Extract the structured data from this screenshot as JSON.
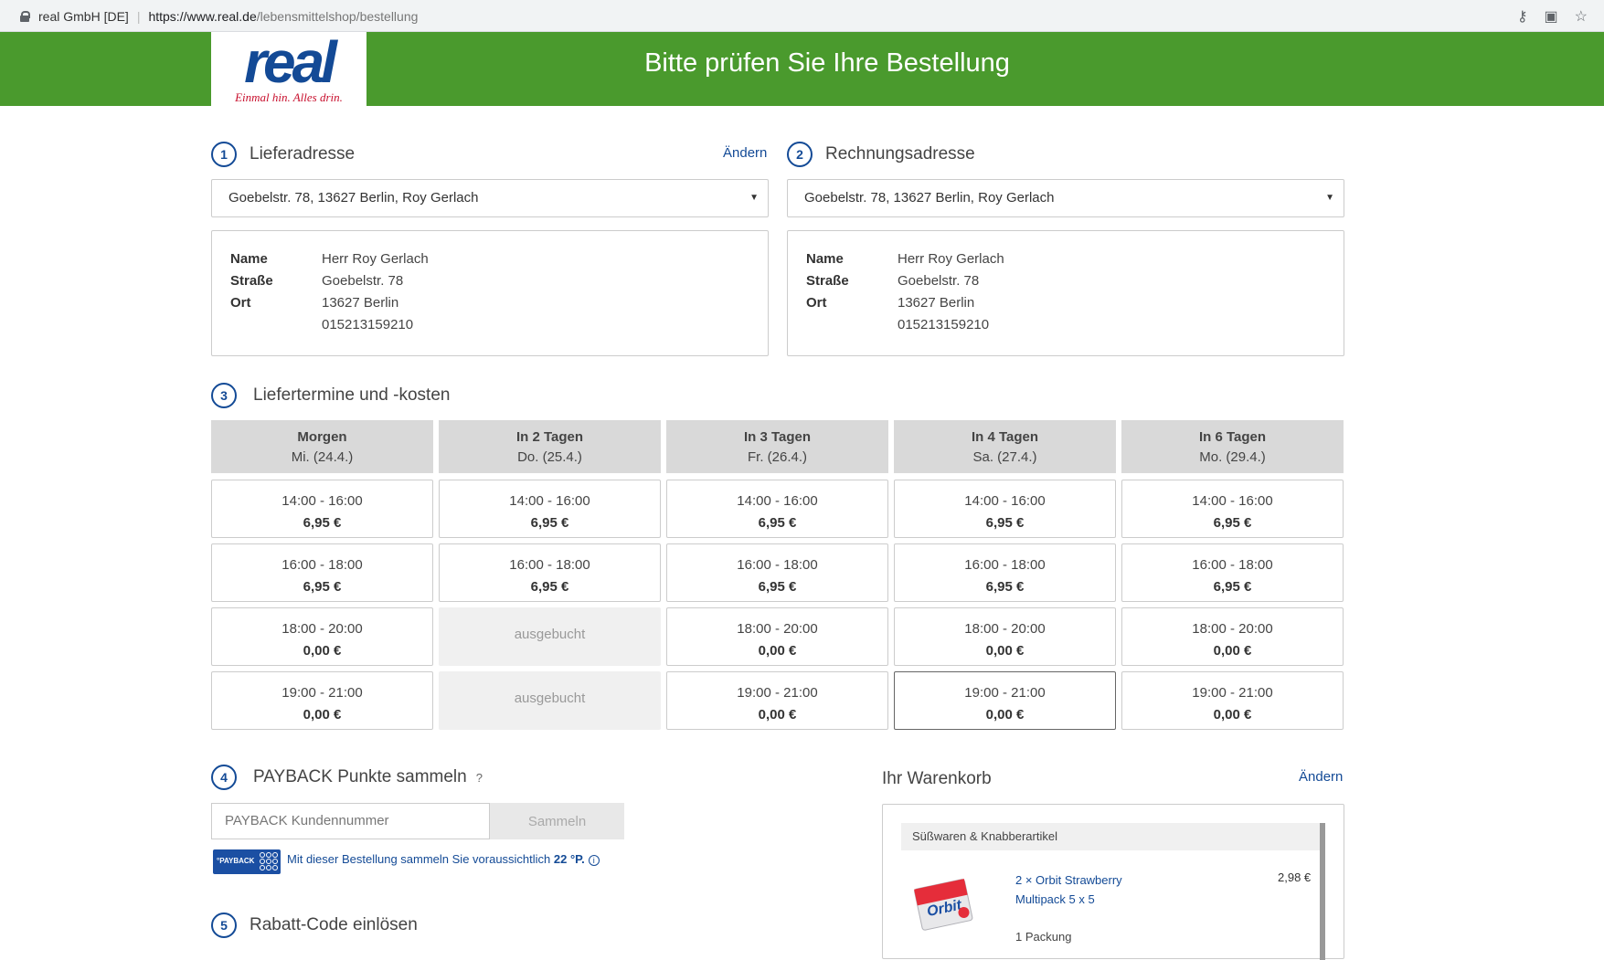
{
  "browser": {
    "site_owner": "real GmbH [DE]",
    "url_host": "https://www.real.de",
    "url_path": "/lebensmittelshop/bestellung"
  },
  "header": {
    "logo_text": "real",
    "logo_slogan": "Einmal hin. Alles drin.",
    "title": "Bitte prüfen Sie Ihre Bestellung"
  },
  "delivery_address": {
    "step": "1",
    "title": "Lieferadresse",
    "change_label": "Ändern",
    "selected": "Goebelstr. 78, 13627 Berlin, Roy Gerlach",
    "name_label": "Name",
    "name": "Herr Roy Gerlach",
    "street_label": "Straße",
    "street": "Goebelstr. 78",
    "city_label": "Ort",
    "city": "13627 Berlin",
    "phone": "015213159210"
  },
  "billing_address": {
    "step": "2",
    "title": "Rechnungsadresse",
    "selected": "Goebelstr. 78, 13627 Berlin, Roy Gerlach",
    "name_label": "Name",
    "name": "Herr Roy Gerlach",
    "street_label": "Straße",
    "street": "Goebelstr. 78",
    "city_label": "Ort",
    "city": "13627 Berlin",
    "phone": "015213159210"
  },
  "delivery_slots": {
    "step": "3",
    "title": "Liefertermine und -kosten",
    "days": [
      {
        "label": "Morgen",
        "date": "Mi. (24.4.)",
        "slots": [
          {
            "time": "14:00 - 16:00",
            "price": "6,95 €"
          },
          {
            "time": "16:00 - 18:00",
            "price": "6,95 €"
          },
          {
            "time": "18:00 - 20:00",
            "price": "0,00 €"
          },
          {
            "time": "19:00 - 21:00",
            "price": "0,00 €"
          }
        ]
      },
      {
        "label": "In 2 Tagen",
        "date": "Do. (25.4.)",
        "slots": [
          {
            "time": "14:00 - 16:00",
            "price": "6,95 €"
          },
          {
            "time": "16:00 - 18:00",
            "price": "6,95 €"
          },
          {
            "booked": "ausgebucht"
          },
          {
            "booked": "ausgebucht"
          }
        ]
      },
      {
        "label": "In 3 Tagen",
        "date": "Fr. (26.4.)",
        "slots": [
          {
            "time": "14:00 - 16:00",
            "price": "6,95 €"
          },
          {
            "time": "16:00 - 18:00",
            "price": "6,95 €"
          },
          {
            "time": "18:00 - 20:00",
            "price": "0,00 €"
          },
          {
            "time": "19:00 - 21:00",
            "price": "0,00 €"
          }
        ]
      },
      {
        "label": "In 4 Tagen",
        "date": "Sa. (27.4.)",
        "slots": [
          {
            "time": "14:00 - 16:00",
            "price": "6,95 €"
          },
          {
            "time": "16:00 - 18:00",
            "price": "6,95 €"
          },
          {
            "time": "18:00 - 20:00",
            "price": "0,00 €"
          },
          {
            "time": "19:00 - 21:00",
            "price": "0,00 €",
            "selected": true
          }
        ]
      },
      {
        "label": "In 6 Tagen",
        "date": "Mo. (29.4.)",
        "slots": [
          {
            "time": "14:00 - 16:00",
            "price": "6,95 €"
          },
          {
            "time": "16:00 - 18:00",
            "price": "6,95 €"
          },
          {
            "time": "18:00 - 20:00",
            "price": "0,00 €"
          },
          {
            "time": "19:00 - 21:00",
            "price": "0,00 €"
          }
        ]
      }
    ]
  },
  "payback": {
    "step": "4",
    "title": "PAYBACK Punkte sammeln",
    "help": "?",
    "placeholder": "PAYBACK Kundennummer",
    "button_label": "Sammeln",
    "logo_text": "°PAYBACK",
    "note_prefix": "Mit dieser Bestellung sammeln Sie voraussichtlich ",
    "note_points": "22 °P.",
    "info": "i"
  },
  "discount": {
    "step": "5",
    "title": "Rabatt-Code einlösen"
  },
  "cart": {
    "title": "Ihr Warenkorb",
    "change_label": "Ändern",
    "category": "Süßwaren & Knabberartikel",
    "product_name": "2 × Orbit Strawberry Multipack 5 x 5",
    "product_price": "2,98 €",
    "product_qty": "1 Packung",
    "product_brand": "Orbit"
  },
  "colors": {
    "brand_green": "#4a9a2d",
    "brand_blue": "#134a96",
    "brand_red": "#c8102e"
  }
}
